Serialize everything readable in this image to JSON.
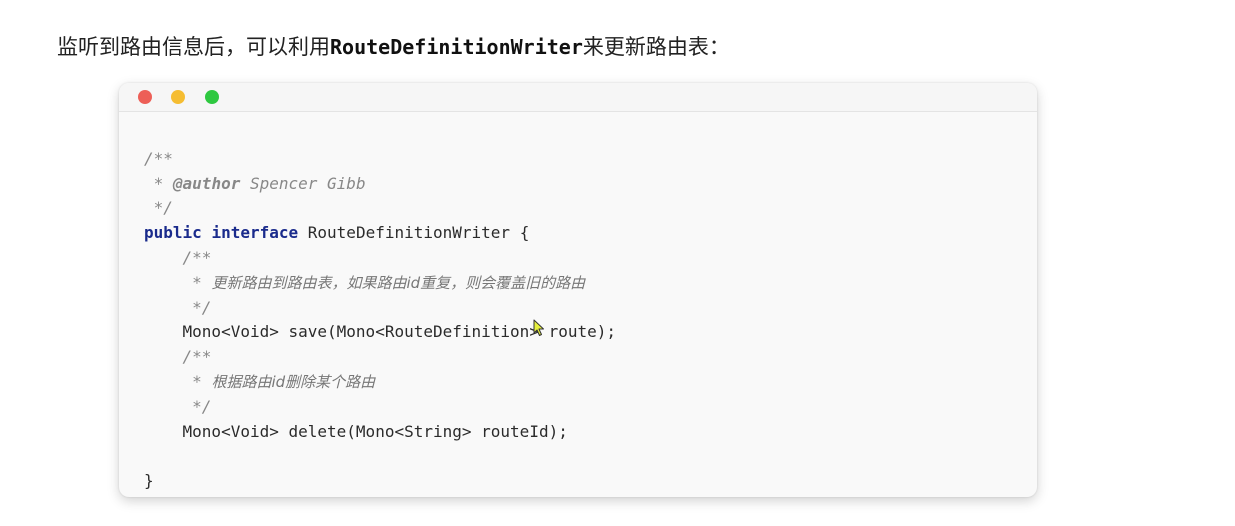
{
  "intro": {
    "prefix": "监听到路由信息后，可以利用",
    "code_word": "RouteDefinitionWriter",
    "suffix": "来更新路由表："
  },
  "code": {
    "lines": [
      "/**",
      " * @author Spencer Gibb",
      " */",
      "public interface RouteDefinitionWriter {",
      "    /**",
      "     * 更新路由到路由表，如果路由id重复，则会覆盖旧的路由",
      "     */",
      "    Mono<Void> save(Mono<RouteDefinition> route);",
      "    /**",
      "     * 根据路由id删除某个路由",
      "     */",
      "    Mono<Void> delete(Mono<String> routeId);",
      "",
      "}"
    ],
    "tokens": {
      "comment_open": "/**",
      "comment_close": " */",
      "star": " * ",
      "author_tag": "@author",
      "author_name": " Spencer Gibb",
      "kw_public": "public",
      "kw_interface": "interface",
      "interface_name": " RouteDefinitionWriter {",
      "save_comment": "更新路由到路由表，如果路由id重复，则会覆盖旧的路由",
      "save_sig": "Mono<Void> save(Mono<RouteDefinition> route);",
      "delete_comment": "根据路由id删除某个路由",
      "delete_sig": "Mono<Void> delete(Mono<String> routeId);",
      "closing_brace": "}"
    }
  },
  "colors": {
    "keyword": "#1a2b8c",
    "comment": "#888888",
    "window_red": "#ed5f57",
    "window_yellow": "#f5bd32",
    "window_green": "#2ec840",
    "cursor_fill": "#e6f03c"
  },
  "icons": {
    "cursor": "mouse-pointer-icon"
  }
}
